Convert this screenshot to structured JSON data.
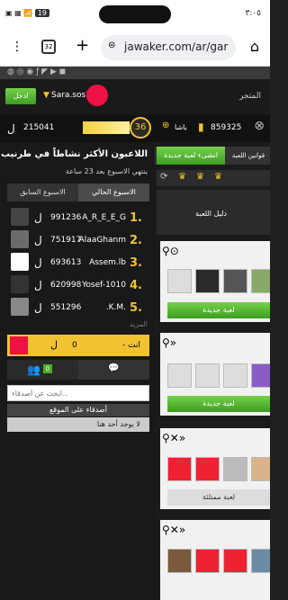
{
  "status": {
    "time": "٣:٠٥",
    "battery": "19"
  },
  "browser": {
    "url": "jawaker.com/ar/gar",
    "tab_count": "32"
  },
  "header": {
    "store_label": "المتجر",
    "login_label": "ادخل",
    "username": "Sara.sos1"
  },
  "stats": {
    "coins": "215041",
    "level": "36",
    "plus_label": "باشا",
    "points": "859325"
  },
  "left": {
    "heading": "اللاعبون الأكثر نشاطاً في طرنيب",
    "subheading": "ينتهي الاسبوع بعد 23 ساعة",
    "tab_current": "الاسبوع الحالي",
    "tab_previous": "الاسبوع السابق",
    "rows": [
      {
        "rank": "1.",
        "name": "A_R_E_E_G",
        "score": "991236"
      },
      {
        "rank": "2.",
        "name": "AlaaGhanm",
        "score": "751917"
      },
      {
        "rank": "3.",
        "name": "Assem.lb",
        "score": "693613"
      },
      {
        "rank": "4.",
        "name": "Yosef-1010",
        "score": "620998"
      },
      {
        "rank": "5.",
        "name": ".K.M.",
        "score": "551296"
      }
    ],
    "more_label": "المزيد",
    "you_label": "- انت",
    "you_score": "0",
    "friends_count": "0",
    "search_placeholder": "ابحث عن أصدقاء...",
    "friends_online": "أصدقاء على الموقع",
    "nobody_here": "لا يوجد أحد هنا"
  },
  "right": {
    "rules_tab": "قوانين اللعبة",
    "new_game_btn": "انشىء لعبة جديدة",
    "guide_label": "دليل اللعبة",
    "new_game_label1": "لعبة جديدة",
    "new_game_label2": "لعبة جديدة",
    "full_game_label": "لعبة ممتلئة"
  },
  "colors": {
    "accent_green": "#4cae2e",
    "gold": "#f2c230"
  }
}
